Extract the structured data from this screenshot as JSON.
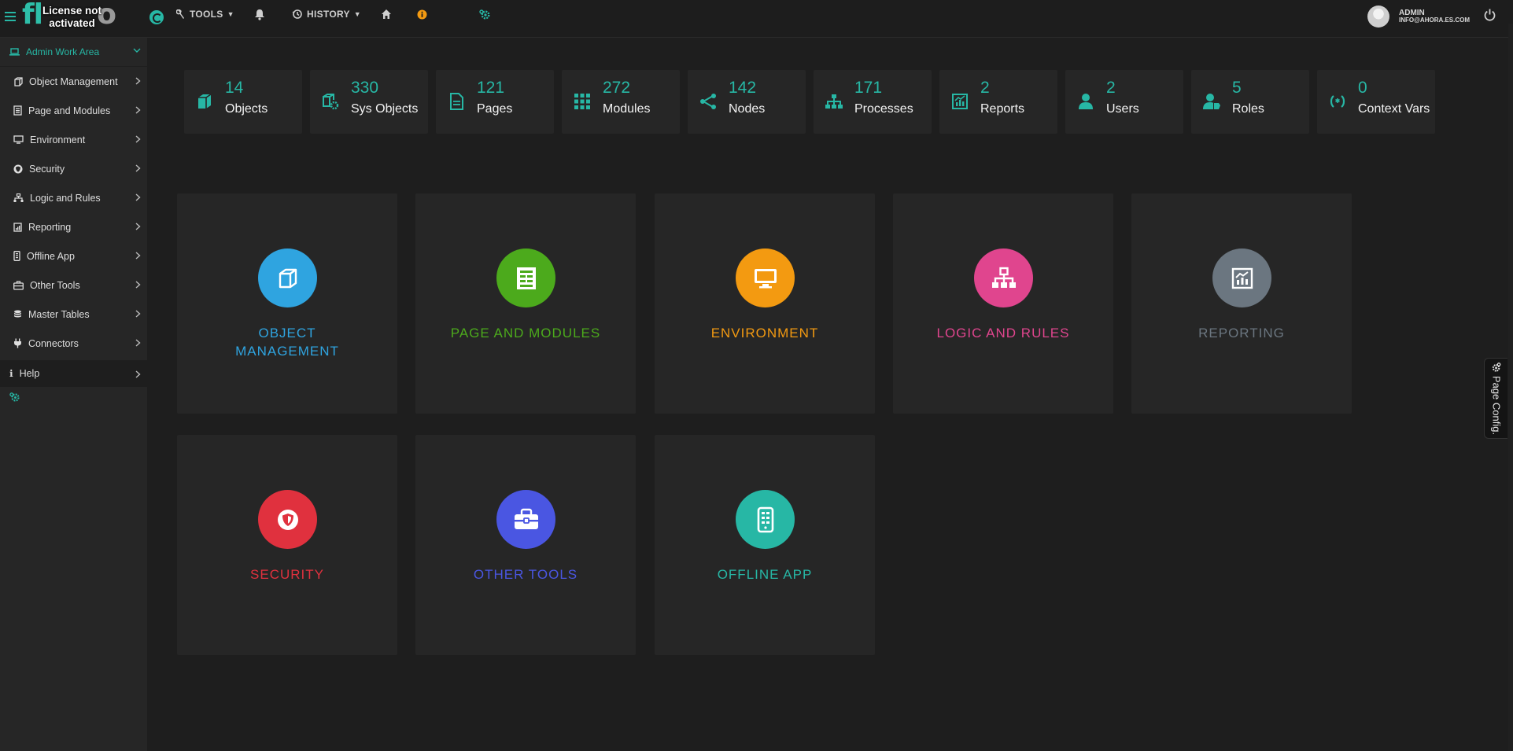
{
  "topbar": {
    "logo_text": "fl",
    "logo_text_end": "o",
    "license_line1": "License not",
    "license_line2": "activated",
    "tools_label": "TOOLS",
    "history_label": "HISTORY",
    "user_name": "ADMIN",
    "user_email": "INFO@AHORA.ES.COM"
  },
  "sidebar": {
    "header": "Admin Work Area",
    "items": [
      {
        "label": "Object Management",
        "icon": "cube-icon"
      },
      {
        "label": "Page and Modules",
        "icon": "page-icon"
      },
      {
        "label": "Environment",
        "icon": "monitor-icon"
      },
      {
        "label": "Security",
        "icon": "shield-icon"
      },
      {
        "label": "Logic and Rules",
        "icon": "sitemap-icon"
      },
      {
        "label": "Reporting",
        "icon": "chart-icon"
      },
      {
        "label": "Offline App",
        "icon": "mobile-icon"
      },
      {
        "label": "Other Tools",
        "icon": "toolbox-icon"
      },
      {
        "label": "Master Tables",
        "icon": "database-icon"
      },
      {
        "label": "Connectors",
        "icon": "plug-icon"
      }
    ],
    "help": "Help"
  },
  "stats": [
    {
      "value": "14",
      "label": "Objects",
      "icon": "cube-icon"
    },
    {
      "value": "330",
      "label": "Sys Objects",
      "icon": "cube-gear-icon"
    },
    {
      "value": "121",
      "label": "Pages",
      "icon": "page-icon"
    },
    {
      "value": "272",
      "label": "Modules",
      "icon": "grid-icon"
    },
    {
      "value": "142",
      "label": "Nodes",
      "icon": "share-icon"
    },
    {
      "value": "171",
      "label": "Processes",
      "icon": "sitemap-icon"
    },
    {
      "value": "2",
      "label": "Reports",
      "icon": "chart-icon"
    },
    {
      "value": "2",
      "label": "Users",
      "icon": "user-icon"
    },
    {
      "value": "5",
      "label": "Roles",
      "icon": "user-tag-icon"
    },
    {
      "value": "0",
      "label": "Context Vars",
      "icon": "braces-icon"
    }
  ],
  "tiles": [
    {
      "title_line1": "OBJECT",
      "title_line2": "MANAGEMENT",
      "color": "#2fa4e0",
      "icon": "cube-icon"
    },
    {
      "title_line1": "PAGE AND MODULES",
      "title_line2": "",
      "color": "#4caa1c",
      "icon": "page-icon"
    },
    {
      "title_line1": "ENVIRONMENT",
      "title_line2": "",
      "color": "#f39a11",
      "icon": "monitor-icon"
    },
    {
      "title_line1": "LOGIC AND RULES",
      "title_line2": "",
      "color": "#e0458e",
      "icon": "sitemap-icon"
    },
    {
      "title_line1": "REPORTING",
      "title_line2": "",
      "color": "#6b7680",
      "icon": "chart-icon"
    },
    {
      "title_line1": "SECURITY",
      "title_line2": "",
      "color": "#e0313e",
      "icon": "shield-icon"
    },
    {
      "title_line1": "OTHER TOOLS",
      "title_line2": "",
      "color": "#4a56e2",
      "icon": "toolbox-icon"
    },
    {
      "title_line1": "OFFLINE APP",
      "title_line2": "",
      "color": "#27b7a5",
      "icon": "mobile-icon"
    }
  ],
  "page_config_label": "Page Config.",
  "colors": {
    "accent": "#27b7a5",
    "background": "#1e1e1e",
    "panel": "#262626"
  }
}
